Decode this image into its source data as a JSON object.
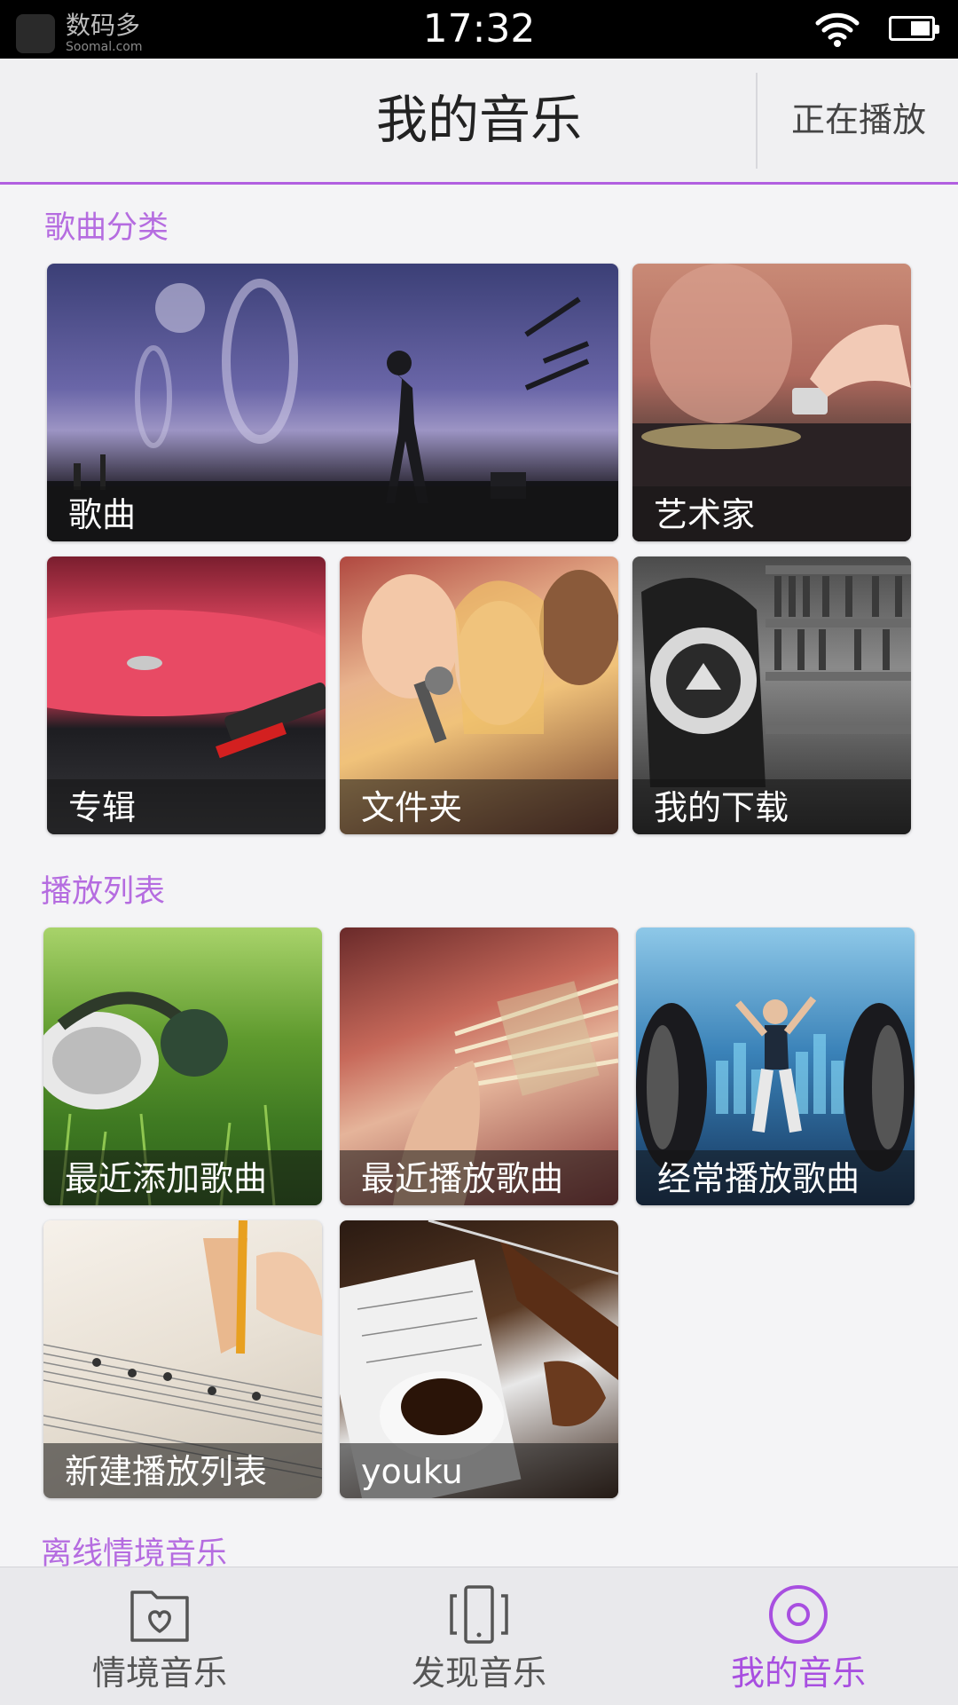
{
  "status_bar": {
    "time": "17:32",
    "watermark_brand": "数码多",
    "watermark_site": "Soomal.com",
    "icons": [
      "wifi-icon",
      "battery-icon"
    ]
  },
  "header": {
    "title": "我的音乐",
    "now_playing": "正在播放"
  },
  "sections": {
    "categories": {
      "title": "歌曲分类",
      "tiles": [
        {
          "label": "歌曲"
        },
        {
          "label": "艺术家"
        },
        {
          "label": "专辑"
        },
        {
          "label": "文件夹"
        },
        {
          "label": "我的下载"
        }
      ]
    },
    "playlists": {
      "title": "播放列表",
      "tiles": [
        {
          "label": "最近添加歌曲"
        },
        {
          "label": "最近播放歌曲"
        },
        {
          "label": "经常播放歌曲"
        },
        {
          "label": "新建播放列表"
        },
        {
          "label": "youku"
        }
      ]
    },
    "offline": {
      "title": "离线情境音乐"
    }
  },
  "bottom_nav": {
    "items": [
      {
        "label": "情境音乐",
        "icon": "folder-heart-icon"
      },
      {
        "label": "发现音乐",
        "icon": "phone-shake-icon"
      },
      {
        "label": "我的音乐",
        "icon": "disc-icon",
        "active": true
      }
    ]
  },
  "colors": {
    "accent": "#b15fe0",
    "section_title": "#b56ce0",
    "status_bar_bg": "#000000",
    "header_bg": "#f0f0f2"
  }
}
